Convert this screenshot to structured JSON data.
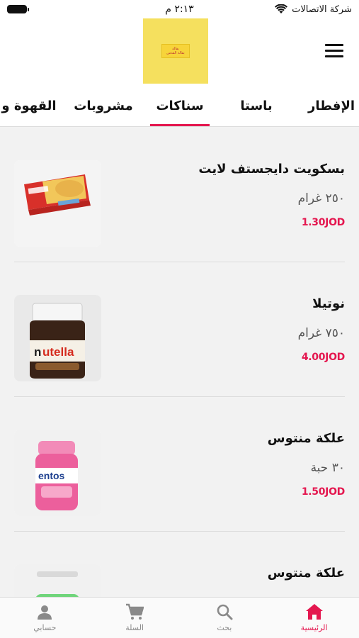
{
  "status_bar": {
    "carrier": "شركة الاتصالات",
    "time": "٢:١٣ م"
  },
  "header": {
    "logo_text_top": "بقالة",
    "logo_text_bottom": "بقالة القدس",
    "menu_icon": "hamburger-menu-icon"
  },
  "tabs": [
    {
      "label": "الإفطار",
      "active": false
    },
    {
      "label": "باستا",
      "active": false
    },
    {
      "label": "سناكات",
      "active": true
    },
    {
      "label": "مشروبات",
      "active": false
    },
    {
      "label": "القهوة و ا",
      "active": false
    }
  ],
  "products": [
    {
      "name": "بسكويت دايجستف لايت",
      "weight": "٢٥٠ غرام",
      "price": "1.30JOD"
    },
    {
      "name": "نوتيلا",
      "weight": "٧٥٠ غرام",
      "price": "4.00JOD"
    },
    {
      "name": "علكة منتوس",
      "weight": "٣٠ حبة",
      "price": "1.50JOD"
    },
    {
      "name": "علكة منتوس",
      "weight": "",
      "price": ""
    }
  ],
  "bottom_nav": [
    {
      "label": "الرئيسية",
      "icon": "home-icon",
      "active": true
    },
    {
      "label": "بحث",
      "icon": "search-icon",
      "active": false
    },
    {
      "label": "السلة",
      "icon": "cart-icon",
      "active": false
    },
    {
      "label": "حسابي",
      "icon": "user-icon",
      "active": false
    }
  ],
  "colors": {
    "accent": "#e4174f",
    "logo_bg": "#f5e05e"
  }
}
